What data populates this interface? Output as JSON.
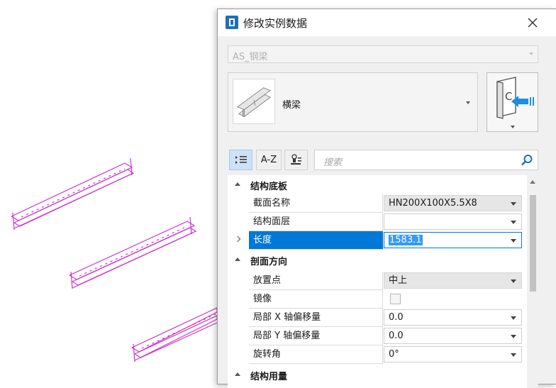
{
  "dialog": {
    "title": "修改实例数据"
  },
  "type_select": {
    "value": "AS_钢梁"
  },
  "element": {
    "label": "横梁"
  },
  "toolbar": {
    "az_label": "A-Z"
  },
  "search": {
    "placeholder": "搜索"
  },
  "categories": [
    {
      "label": "结构底板",
      "properties": [
        {
          "name": "截面名称",
          "value": "HN200X100X5.5X8"
        },
        {
          "name": "结构面层",
          "value": ""
        },
        {
          "name": "长度",
          "value": "1583.1"
        }
      ]
    },
    {
      "label": "剖面方向",
      "properties": [
        {
          "name": "放置点",
          "value": "中上"
        },
        {
          "name": "镜像",
          "value": ""
        },
        {
          "name": "局部 X 轴偏移量",
          "value": "0.0"
        },
        {
          "name": "局部 Y 轴偏移量",
          "value": "0.0"
        },
        {
          "name": "旋转角",
          "value": "0°"
        }
      ]
    },
    {
      "label": "结构用量"
    }
  ],
  "colors": {
    "beam": "#cc33cc",
    "selection": "#0078d7",
    "text_highlight": "#3399ff",
    "icon_blue": "#1d8fe0"
  },
  "icons": [
    "app-icon",
    "close-icon",
    "beam-thumbnail-icon",
    "import-book-icon",
    "categorized-view-icon",
    "filter-icon",
    "search-icon"
  ]
}
